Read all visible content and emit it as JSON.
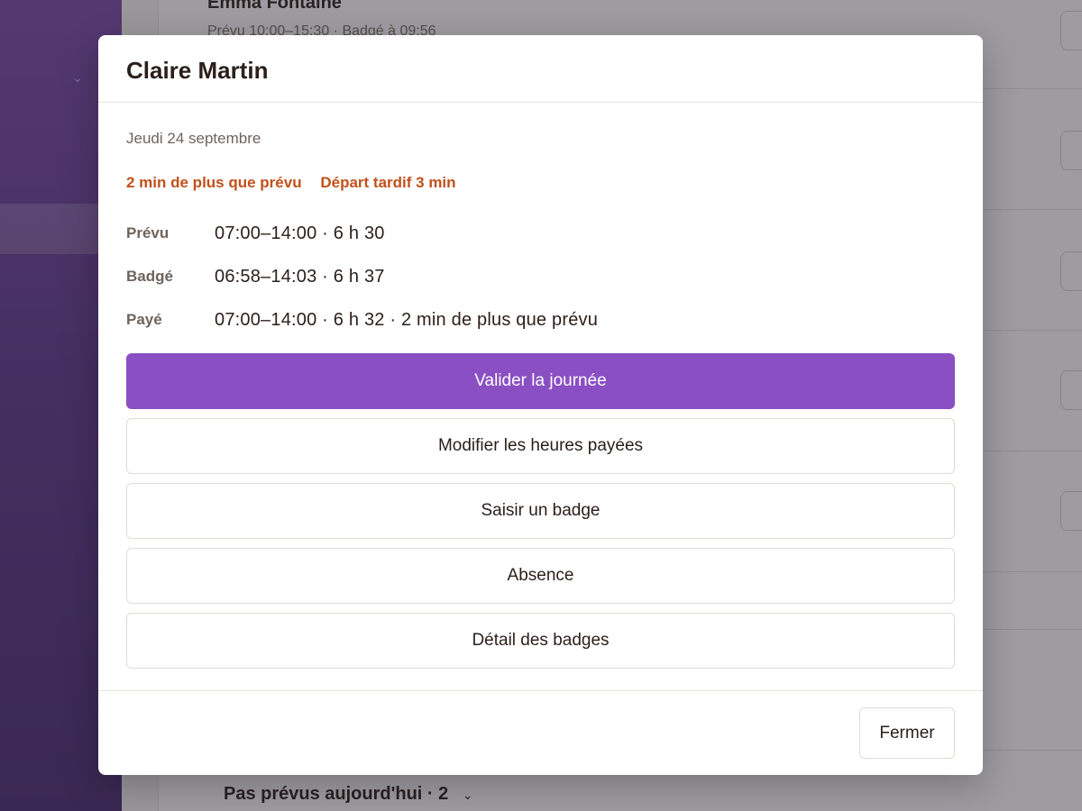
{
  "background": {
    "rows": [
      {
        "name": "Emma Fontaine",
        "sub": "Prévu 10:00–15:30 · Badgé à 09:56"
      }
    ],
    "footer_section": "Pas prévus aujourd'hui · 2"
  },
  "modal": {
    "title": "Claire Martin",
    "date": "Jeudi 24 septembre",
    "warnings": [
      "2 min de plus que prévu",
      "Départ tardif 3 min"
    ],
    "times": [
      {
        "label": "Prévu",
        "value": "07:00–14:00 · 6 h 30"
      },
      {
        "label": "Badgé",
        "value": "06:58–14:03 · 6 h 37"
      },
      {
        "label": "Payé",
        "value": "07:00–14:00 · 6 h 32 · 2 min de plus que prévu"
      }
    ],
    "actions": {
      "primary": "Valider la journée",
      "secondary": [
        "Modifier les heures payées",
        "Saisir un badge",
        "Absence",
        "Détail des badges"
      ]
    },
    "close_label": "Fermer"
  },
  "colors": {
    "primary": "#8a4fc3",
    "warning": "#c2501a",
    "sidebar": "#6a3f9a"
  }
}
